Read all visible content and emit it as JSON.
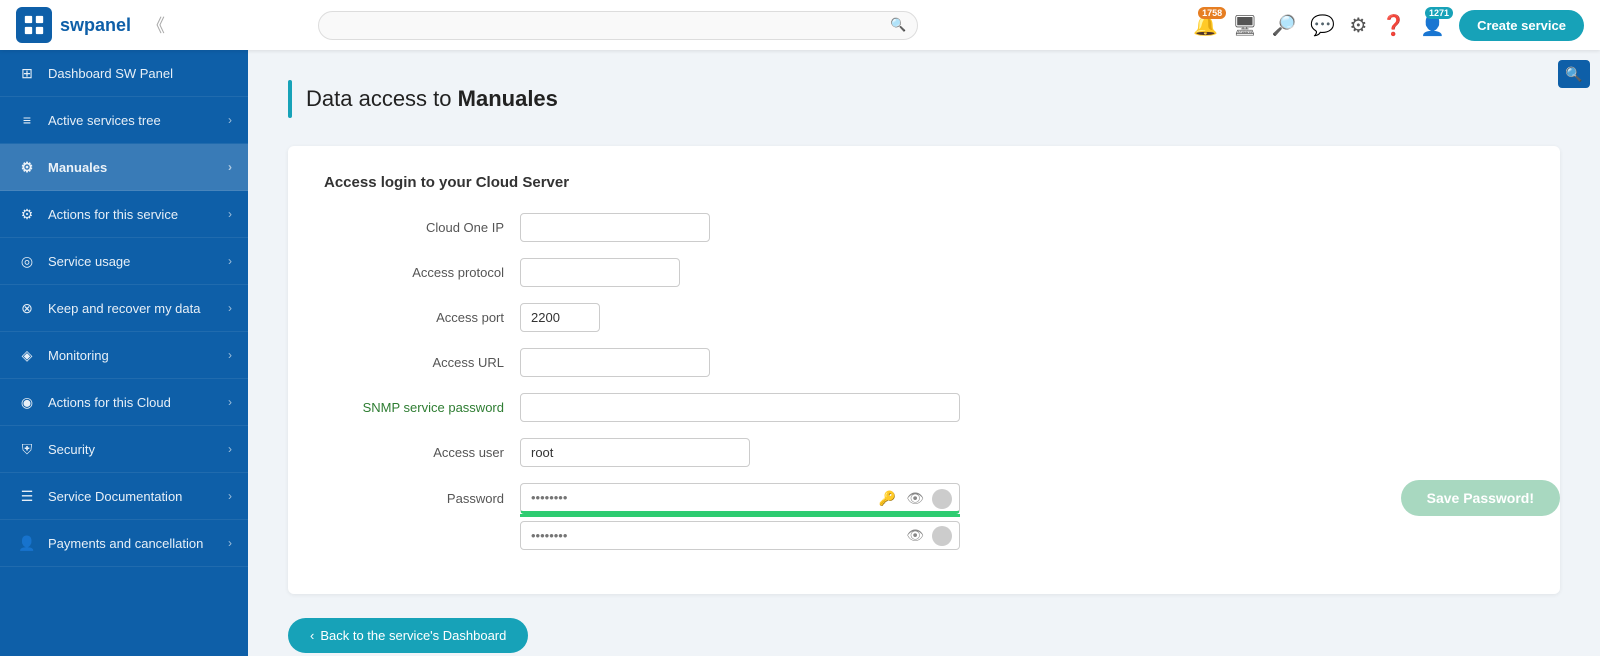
{
  "brand": {
    "logo_alt": "swpanel logo",
    "title": "swpanel"
  },
  "navbar": {
    "collapse_title": "collapse sidebar",
    "search_placeholder": "",
    "create_service_label": "Create service",
    "badge_notifications": "1758",
    "badge_messages": "1271"
  },
  "sidebar": {
    "items": [
      {
        "id": "dashboard",
        "label": "Dashboard SW Panel",
        "icon": "⊞",
        "has_arrow": false,
        "active": false
      },
      {
        "id": "active-services",
        "label": "Active services tree",
        "icon": "≡",
        "has_arrow": true,
        "active": false
      },
      {
        "id": "manuales",
        "label": "Manuales",
        "icon": "⚙",
        "has_arrow": true,
        "active": true
      },
      {
        "id": "actions-service",
        "label": "Actions for this service",
        "icon": "⚙",
        "has_arrow": true,
        "active": false
      },
      {
        "id": "service-usage",
        "label": "Service usage",
        "icon": "@",
        "has_arrow": true,
        "active": false
      },
      {
        "id": "keep-recover",
        "label": "Keep and recover my data",
        "icon": "⊗",
        "has_arrow": true,
        "active": false
      },
      {
        "id": "monitoring",
        "label": "Monitoring",
        "icon": "◈",
        "has_arrow": true,
        "active": false
      },
      {
        "id": "actions-cloud",
        "label": "Actions for this Cloud",
        "icon": "◉",
        "has_arrow": true,
        "active": false
      },
      {
        "id": "security",
        "label": "Security",
        "icon": "⛨",
        "has_arrow": true,
        "active": false
      },
      {
        "id": "service-doc",
        "label": "Service Documentation",
        "icon": "☰",
        "has_arrow": true,
        "active": false
      },
      {
        "id": "payments",
        "label": "Payments and cancellation",
        "icon": "👤",
        "has_arrow": true,
        "active": false
      }
    ]
  },
  "page": {
    "title_prefix": "Data access to ",
    "title_bold": "Manuales"
  },
  "card": {
    "section_title": "Access login to your Cloud Server",
    "fields": [
      {
        "label": "Cloud One IP",
        "value": "",
        "type": "text",
        "size": "short"
      },
      {
        "label": "Access protocol",
        "value": "",
        "type": "text",
        "size": "medium"
      },
      {
        "label": "Access port",
        "value": "2200",
        "type": "text",
        "size": "port"
      },
      {
        "label": "Access URL",
        "value": "",
        "type": "text",
        "size": "short"
      },
      {
        "label": "SNMP service password",
        "value": "",
        "type": "password",
        "size": "long",
        "highlight": true
      },
      {
        "label": "Access user",
        "value": "root",
        "type": "text",
        "size": "user"
      }
    ],
    "password_label": "Password",
    "password_placeholder": "••••••••",
    "password_confirm_placeholder": "••••••••"
  },
  "buttons": {
    "save_password": "Save Password!",
    "back_label": "Back to the service's Dashboard",
    "back_arrow": "‹"
  }
}
